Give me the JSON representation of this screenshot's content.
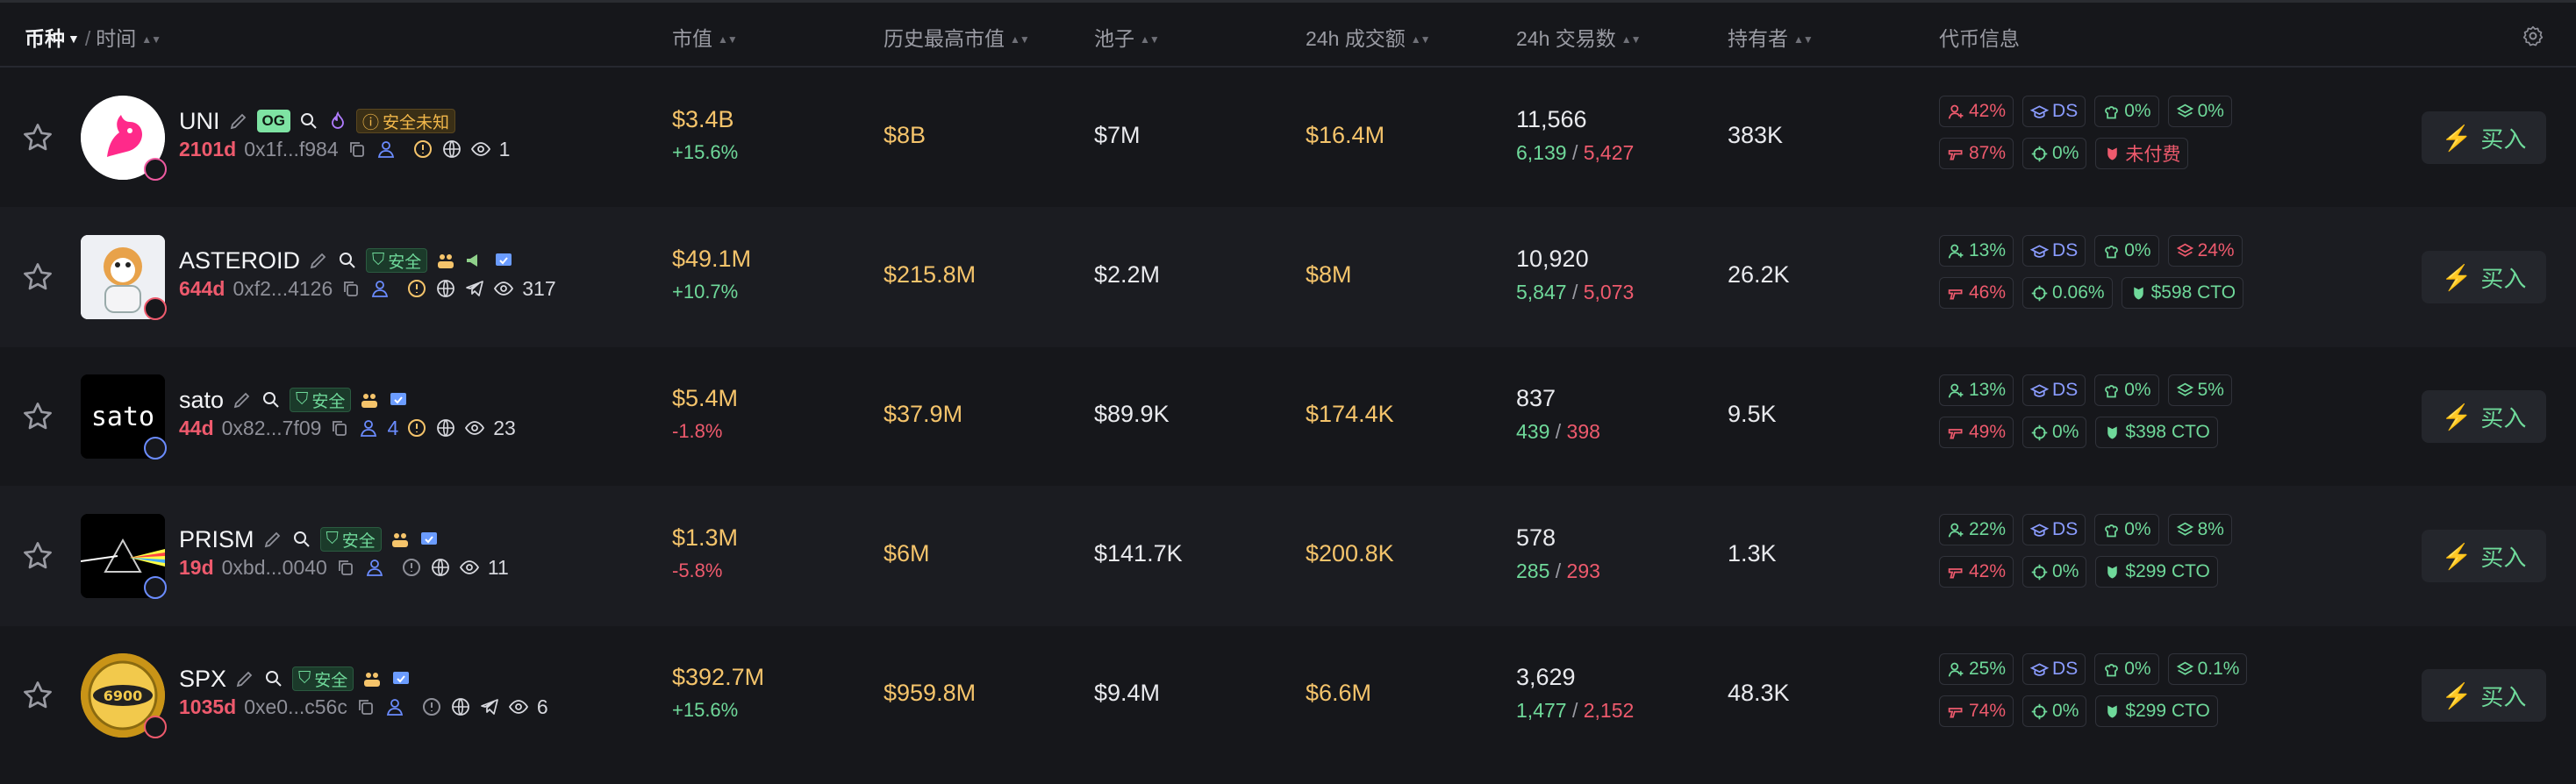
{
  "header": {
    "symbol": "币种",
    "time": "时间",
    "market_cap": "市值",
    "ath_market_cap": "历史最高市值",
    "pool": "池子",
    "volume_24h": "24h 成交额",
    "txns_24h": "24h 交易数",
    "holders": "持有者",
    "token_info": "代币信息"
  },
  "buy_label": "买入",
  "safe_label": "安全",
  "unknown_label": "安全未知",
  "og_label": "OG",
  "colors": {
    "green": "#6fd99a",
    "red": "#ee5a6d",
    "gold": "#f5c46b",
    "blue": "#8a9cff"
  },
  "rows": [
    {
      "name": "UNI",
      "age": "2101d",
      "address": "0x1f...f984",
      "views": "1",
      "holders_small": "",
      "market_cap": "$3.4B",
      "change": "+15.6%",
      "ath": "$8B",
      "pool": "$7M",
      "volume": "$16.4M",
      "txns": "11,566",
      "buys": "6,139",
      "sells": "5,427",
      "holders": "383K",
      "info": {
        "top10": "42%",
        "ds": "DS",
        "dev": "0%",
        "lp": "0%",
        "sniper": "87%",
        "insider": "0%",
        "extra": "未付费"
      }
    },
    {
      "name": "ASTEROID",
      "age": "644d",
      "address": "0xf2...4126",
      "views": "317",
      "holders_small": "",
      "market_cap": "$49.1M",
      "change": "+10.7%",
      "ath": "$215.8M",
      "pool": "$2.2M",
      "volume": "$8M",
      "txns": "10,920",
      "buys": "5,847",
      "sells": "5,073",
      "holders": "26.2K",
      "info": {
        "top10": "13%",
        "ds": "DS",
        "dev": "0%",
        "lp": "24%",
        "sniper": "46%",
        "insider": "0.06%",
        "extra": "$598 CTO"
      }
    },
    {
      "name": "sato",
      "age": "44d",
      "address": "0x82...7f09",
      "views": "23",
      "holders_small": "4",
      "market_cap": "$5.4M",
      "change": "-1.8%",
      "ath": "$37.9M",
      "pool": "$89.9K",
      "volume": "$174.4K",
      "txns": "837",
      "buys": "439",
      "sells": "398",
      "holders": "9.5K",
      "info": {
        "top10": "13%",
        "ds": "DS",
        "dev": "0%",
        "lp": "5%",
        "sniper": "49%",
        "insider": "0%",
        "extra": "$398 CTO"
      }
    },
    {
      "name": "PRISM",
      "age": "19d",
      "address": "0xbd...0040",
      "views": "11",
      "holders_small": "",
      "market_cap": "$1.3M",
      "change": "-5.8%",
      "ath": "$6M",
      "pool": "$141.7K",
      "volume": "$200.8K",
      "txns": "578",
      "buys": "285",
      "sells": "293",
      "holders": "1.3K",
      "info": {
        "top10": "22%",
        "ds": "DS",
        "dev": "0%",
        "lp": "8%",
        "sniper": "42%",
        "insider": "0%",
        "extra": "$299 CTO"
      }
    },
    {
      "name": "SPX",
      "age": "1035d",
      "address": "0xe0...c56c",
      "views": "6",
      "holders_small": "",
      "market_cap": "$392.7M",
      "change": "+15.6%",
      "ath": "$959.8M",
      "pool": "$9.4M",
      "volume": "$6.6M",
      "txns": "3,629",
      "buys": "1,477",
      "sells": "2,152",
      "holders": "48.3K",
      "info": {
        "top10": "25%",
        "ds": "DS",
        "dev": "0%",
        "lp": "0.1%",
        "sniper": "74%",
        "insider": "0%",
        "extra": "$299 CTO"
      }
    }
  ]
}
